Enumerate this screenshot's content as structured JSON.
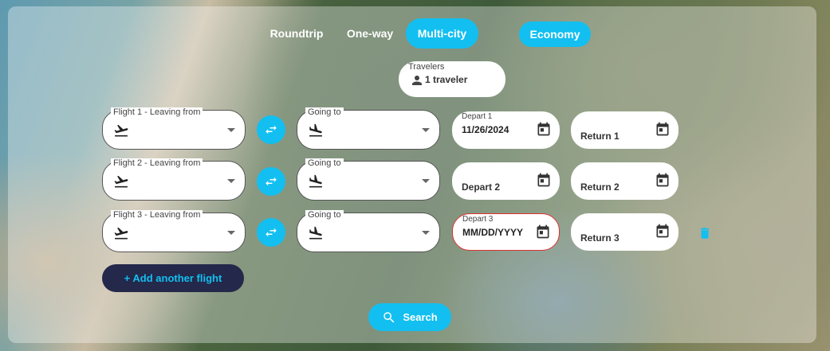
{
  "trip_types": [
    "Roundtrip",
    "One-way",
    "Multi-city"
  ],
  "active_trip_type": "Multi-city",
  "cabin_class": "Economy",
  "travelers": {
    "label": "Travelers",
    "value": "1 traveler"
  },
  "flights": [
    {
      "from_label": "Flight 1 - Leaving from",
      "to_label": "Going to",
      "depart_label": "Depart 1",
      "depart_value": "11/26/2024",
      "return_placeholder": "Return 1"
    },
    {
      "from_label": "Flight 2 - Leaving from",
      "to_label": "Going to",
      "depart_placeholder": "Depart 2",
      "return_placeholder": "Return 2"
    },
    {
      "from_label": "Flight 3 - Leaving from",
      "to_label": "Going to",
      "depart_label": "Depart 3",
      "depart_value": "MM/DD/YYYY",
      "return_placeholder": "Return 3"
    }
  ],
  "add_flight_label": "+ Add another flight",
  "search_label": "Search",
  "colors": {
    "accent": "#12bff0",
    "dark_button": "#24284a",
    "error": "#dd3333"
  },
  "icons": [
    "person-icon",
    "takeoff-icon",
    "landing-icon",
    "swap-icon",
    "calendar-icon",
    "trash-icon",
    "search-icon"
  ]
}
